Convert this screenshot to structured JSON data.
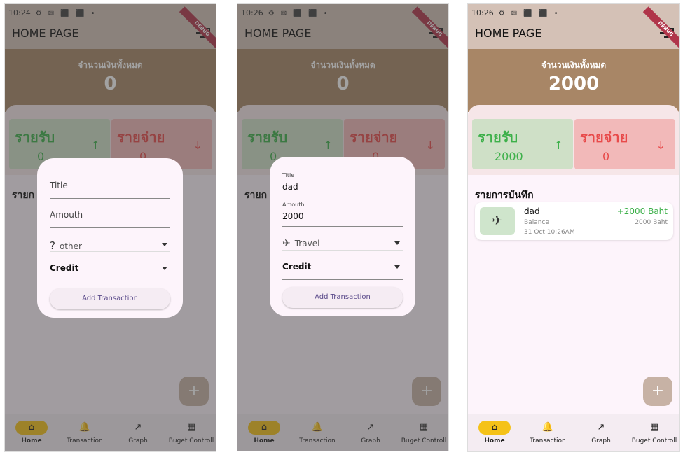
{
  "status": {
    "time1": "10:24",
    "time2": "10:26",
    "time3": "10:26",
    "icons": "⚙ ✉ ⬛ ⬛ •"
  },
  "appbar": {
    "title": "HOME PAGE"
  },
  "debug_label": "DEBUG",
  "summary": {
    "label": "จำนวนเงินทั้งหมด",
    "total_empty": "0",
    "total_final": "2000"
  },
  "income": {
    "label": "รายรับ",
    "value_empty": "0",
    "value_final": "2000",
    "arrow": "↑"
  },
  "expense": {
    "label": "รายจ่าย",
    "value": "0",
    "arrow": "↓"
  },
  "list_title": "รายการบันทึก",
  "list_title_cut": "รายก",
  "fab": "+",
  "nav": [
    {
      "label": "Home",
      "icon": "⌂"
    },
    {
      "label": "Transaction",
      "icon": "🔔"
    },
    {
      "label": "Graph",
      "icon": "↗"
    },
    {
      "label": "Buget Controll",
      "icon": "▦"
    }
  ],
  "dialog1": {
    "title_ph": "Title",
    "amount_ph": "Amouth",
    "category": "other",
    "category_icon": "?",
    "type": "Credit",
    "button": "Add Transaction"
  },
  "dialog2": {
    "title_label": "Title",
    "title_val": "dad",
    "amount_label": "Amouth",
    "amount_val": "2000",
    "category": "Travel",
    "category_icon": "✈",
    "type": "Credit",
    "button": "Add Transaction"
  },
  "transaction": {
    "name": "dad",
    "amount": "+2000 Baht",
    "balance_label": "Balance",
    "balance_value": "2000 Baht",
    "date": "31 Oct 10:26AM",
    "icon": "✈"
  }
}
